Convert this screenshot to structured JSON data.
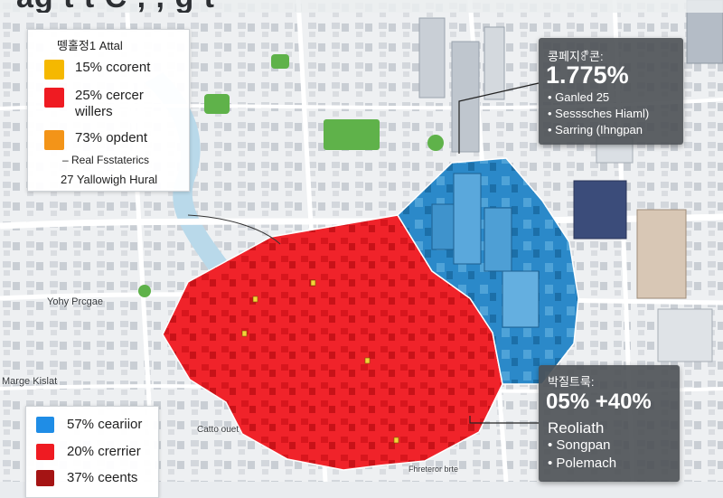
{
  "map": {
    "title": "ag  t    t       C    ,     ,   g    t",
    "colors": {
      "red_zone": "#f0232a",
      "blue_zone": "#2b89c9",
      "park": "#5fb24a",
      "water": "#b9d9ea",
      "road": "#ffffff"
    },
    "labels": {
      "left_mid": "Yohy Prcgae",
      "left_low": "Marge Kislat",
      "bottom_center": "Catto ouet",
      "bottom_right": "Fhreteror brte"
    }
  },
  "legend_top": {
    "title": "뗑홀정1 Attal",
    "items": [
      {
        "color": "#f5b800",
        "label": "15% ccorent",
        "icon": "yellow-swatch"
      },
      {
        "color": "#ef1b22",
        "label": "25% cercer willers",
        "icon": "red-swatch"
      },
      {
        "color": "#f39418",
        "label": "73% opdent",
        "icon": "orange-swatch"
      }
    ],
    "note1": "– Real Fsstaterics",
    "note2": "27 Yallowigh Hural"
  },
  "legend_bottom": {
    "items": [
      {
        "color": "#1f8de6",
        "label": "57% ceariior",
        "icon": "blue-swatch"
      },
      {
        "color": "#ef1b22",
        "label": "20% crerrier",
        "icon": "red-swatch"
      },
      {
        "color": "#a51414",
        "label": "37% ceents",
        "icon": "dark-red-swatch"
      }
    ]
  },
  "callout_top": {
    "heading": "콩페지ꍗ콘:",
    "value": "1.775%",
    "items": [
      "• Ganled 25",
      "• Sesssches Hiaml)",
      "• Sarring (Ihngpan"
    ]
  },
  "callout_bottom": {
    "heading": "박질트룩:",
    "value": "05% +40%",
    "subtitle": "Reoliath",
    "items": [
      "• Songpan",
      "• Polemach"
    ]
  }
}
